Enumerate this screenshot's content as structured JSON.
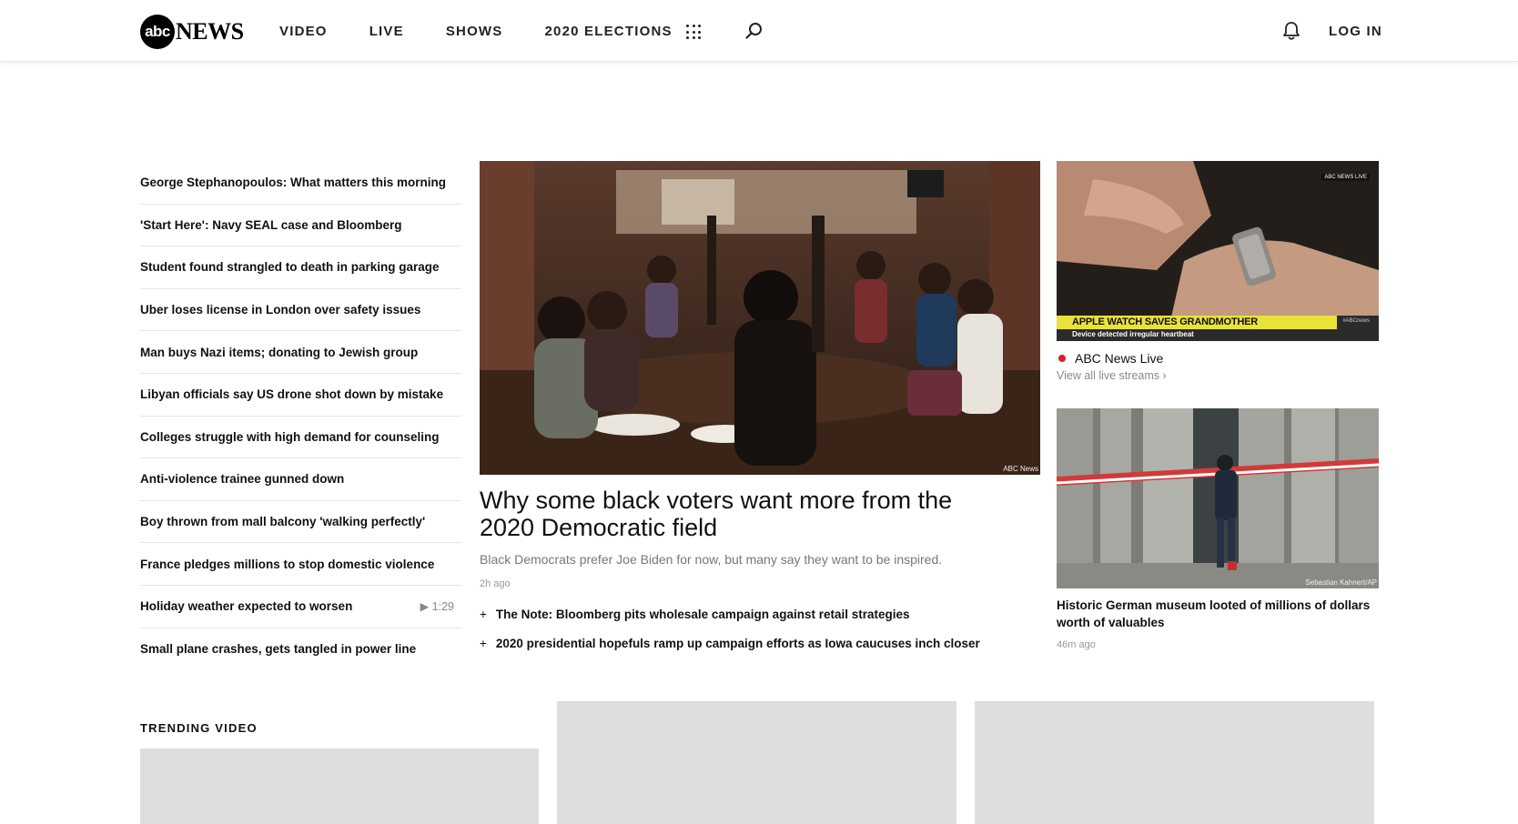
{
  "header": {
    "logo_badge": "abc",
    "logo_word": "NEWS",
    "nav": [
      "VIDEO",
      "LIVE",
      "SHOWS",
      "2020 ELECTIONS"
    ],
    "login_label": "LOG IN",
    "icons": [
      "apps-grid-icon",
      "search-icon",
      "bell-icon"
    ]
  },
  "headlines": [
    {
      "title": "George Stephanopoulos: What matters this morning",
      "duration": ""
    },
    {
      "title": "'Start Here': Navy SEAL case and Bloomberg",
      "duration": ""
    },
    {
      "title": "Student found strangled to death in parking garage",
      "duration": ""
    },
    {
      "title": "Uber loses license in London over safety issues",
      "duration": ""
    },
    {
      "title": "Man buys Nazi items; donating to Jewish group",
      "duration": ""
    },
    {
      "title": "Libyan officials say US drone shot down by mistake",
      "duration": ""
    },
    {
      "title": "Colleges struggle with high demand for counseling",
      "duration": ""
    },
    {
      "title": "Anti-violence trainee gunned down",
      "duration": ""
    },
    {
      "title": "Boy thrown from mall balcony 'walking perfectly'",
      "duration": ""
    },
    {
      "title": "France pledges millions to stop domestic violence",
      "duration": ""
    },
    {
      "title": "Holiday weather expected to worsen",
      "duration": "▶ 1:29"
    },
    {
      "title": "Small plane crashes, gets tangled in power line",
      "duration": ""
    }
  ],
  "lead": {
    "image_credit": "ABC News",
    "title": "Why some black voters want more from the 2020 Democratic field",
    "description": "Black Democrats prefer Joe Biden for now, but many say they want to be inspired.",
    "time": "2h ago",
    "related": [
      "The Note: Bloomberg pits wholesale campaign against retail strategies",
      "2020 presidential hopefuls ramp up campaign efforts as Iowa caucuses inch closer"
    ]
  },
  "live": {
    "banner_headline": "APPLE WATCH SAVES GRANDMOTHER",
    "banner_sub": "Device detected irregular heartbeat",
    "banner_tag": "#ABCnews",
    "bug": "ABC NEWS LIVE",
    "label": "ABC News Live",
    "link": "View all live streams ›"
  },
  "side_story": {
    "image_credit": "Sebastian Kahnert/AP",
    "title": "Historic German museum looted of millions of dollars worth of valuables",
    "time": "46m ago"
  },
  "trending": {
    "label": "TRENDING VIDEO"
  },
  "colors": {
    "live_dot": "#e01e1e",
    "banner_yellow": "#e8e23a",
    "placeholder": "#dedede"
  }
}
